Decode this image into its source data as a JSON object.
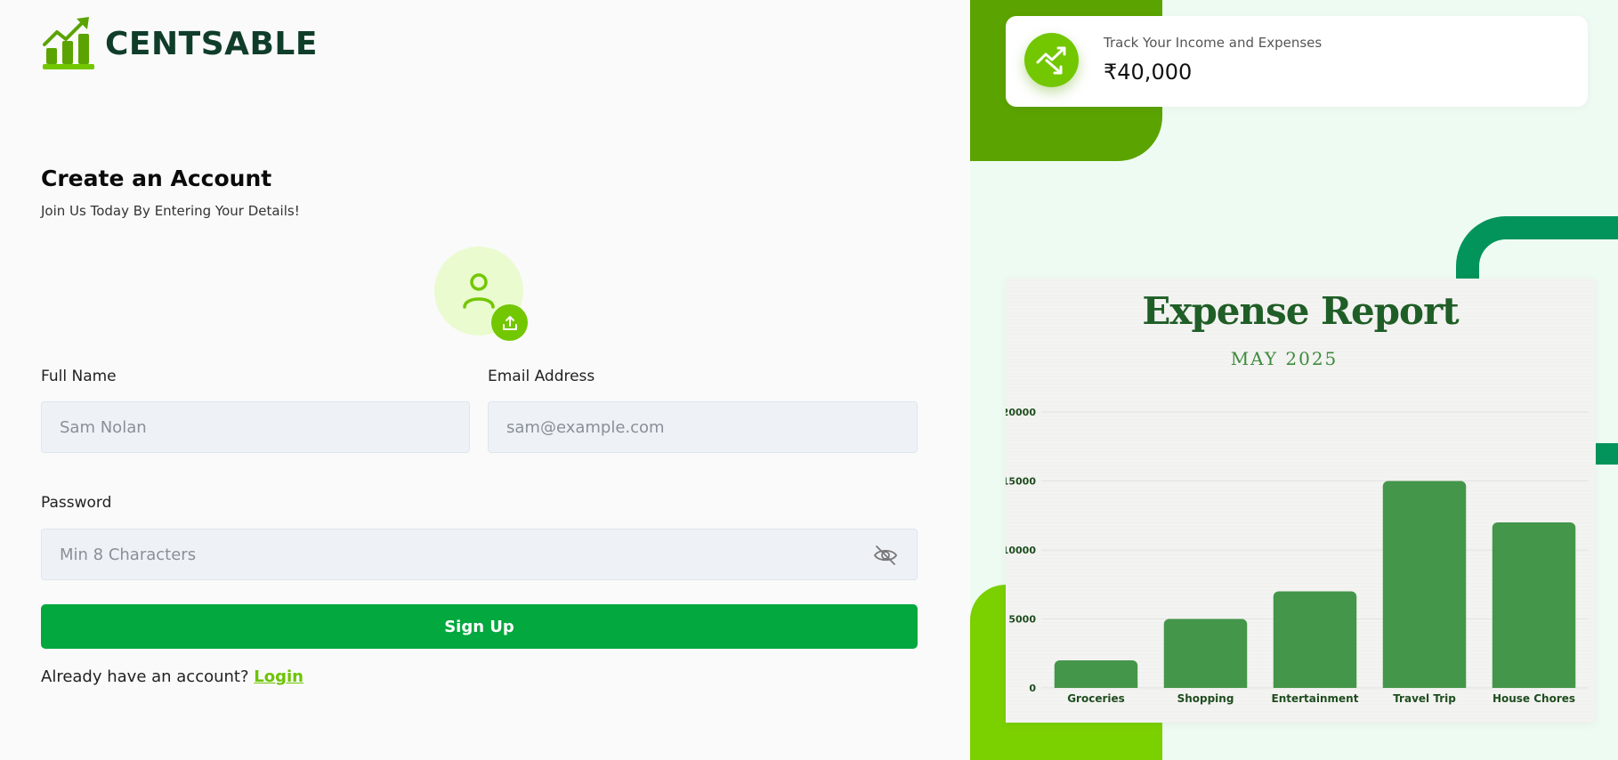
{
  "brand": {
    "name": "CENTSABLE"
  },
  "form": {
    "title": "Create an Account",
    "subtitle": "Join Us Today By Entering Your Details!",
    "full_name_label": "Full Name",
    "full_name_placeholder": "Sam Nolan",
    "email_label": "Email Address",
    "email_placeholder": "sam@example.com",
    "password_label": "Password",
    "password_placeholder": "Min 8 Characters",
    "signup_label": "Sign Up",
    "footer_text": "Already have an account?",
    "login_label": "Login"
  },
  "stat_card": {
    "label": "Track Your Income and Expenses",
    "value": "₹40,000"
  },
  "report": {
    "title": "Expense Report",
    "subtitle": "MAY 2025"
  },
  "colors": {
    "brand_green": "#72c700",
    "dark_green": "#0f3d2a",
    "signup_green": "#03a83e",
    "bar_green": "#44964a",
    "panel_bg": "#eefbf2"
  },
  "chart_data": {
    "type": "bar",
    "categories": [
      "Groceries",
      "Shopping",
      "Entertainment",
      "Travel Trip",
      "House Chores"
    ],
    "values": [
      2000,
      5000,
      7000,
      15000,
      12000
    ],
    "yticks": [
      0,
      5000,
      10000,
      15000,
      20000
    ],
    "ylim": [
      0,
      20000
    ],
    "grid": true
  }
}
